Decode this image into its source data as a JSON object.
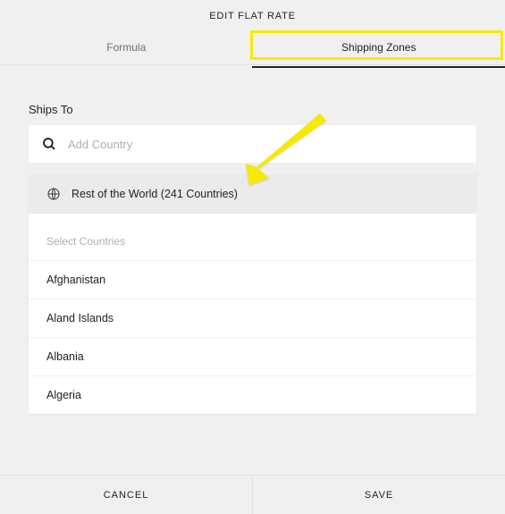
{
  "title": "EDIT FLAT RATE",
  "tabs": {
    "formula": "Formula",
    "shipping_zones": "Shipping Zones"
  },
  "section_label": "Ships To",
  "search": {
    "placeholder": "Add Country"
  },
  "rest_of_world": "Rest of the World (241 Countries)",
  "countries_header": "Select Countries",
  "countries": [
    "Afghanistan",
    "Aland Islands",
    "Albania",
    "Algeria"
  ],
  "footer": {
    "cancel": "CANCEL",
    "save": "SAVE"
  }
}
